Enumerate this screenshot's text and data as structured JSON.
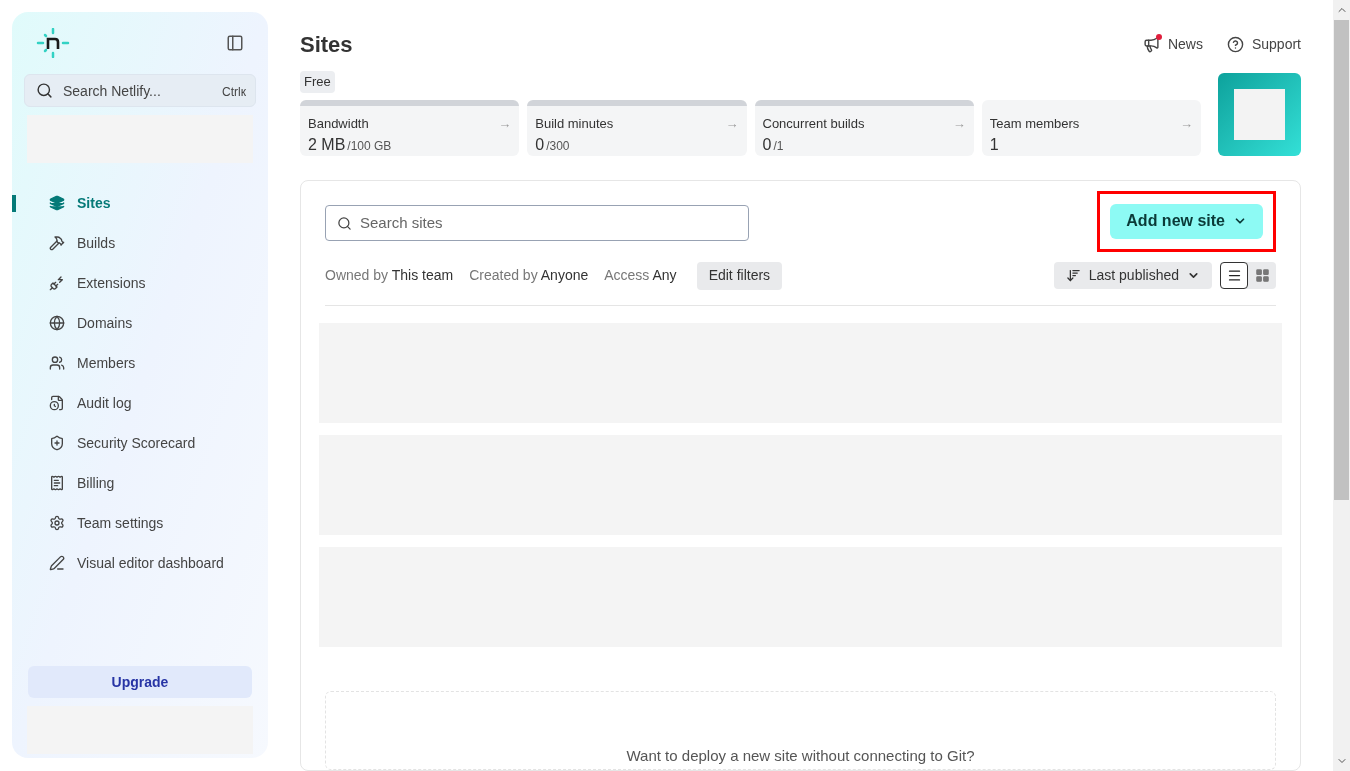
{
  "sidebar": {
    "search": {
      "placeholder": "Search Netlify...",
      "shortcut": "Ctrlк"
    },
    "items": [
      {
        "label": "Sites",
        "selected": true
      },
      {
        "label": "Builds",
        "selected": false
      },
      {
        "label": "Extensions",
        "selected": false
      },
      {
        "label": "Domains",
        "selected": false
      },
      {
        "label": "Members",
        "selected": false
      },
      {
        "label": "Audit log",
        "selected": false
      },
      {
        "label": "Security Scorecard",
        "selected": false
      },
      {
        "label": "Billing",
        "selected": false
      },
      {
        "label": "Team settings",
        "selected": false
      },
      {
        "label": "Visual editor dashboard",
        "selected": false
      }
    ],
    "upgrade": "Upgrade"
  },
  "header": {
    "title": "Sites",
    "news": {
      "label": "News",
      "unread": true
    },
    "support": "Support"
  },
  "plan": "Free",
  "usage": [
    {
      "label": "Bandwidth",
      "value": "2 MB",
      "limit": "/100 GB",
      "meter": true,
      "arrow": "→"
    },
    {
      "label": "Build minutes",
      "value": "0",
      "limit": "/300",
      "meter": true,
      "arrow": "→"
    },
    {
      "label": "Concurrent builds",
      "value": "0",
      "limit": "/1",
      "meter": true,
      "arrow": "→"
    },
    {
      "label": "Team members",
      "value": "1",
      "meter": false,
      "arrow": "→"
    }
  ],
  "sites": {
    "search": {
      "placeholder": "Search sites"
    },
    "add_button": {
      "label": "Add new site",
      "highlighted": true
    },
    "filters": [
      {
        "label": "Owned by",
        "value": "This team"
      },
      {
        "label": "Created by",
        "value": "Anyone"
      },
      {
        "label": "Access",
        "value": "Any"
      }
    ],
    "edit_filters": "Edit filters",
    "sort": "Last published",
    "views": [
      {
        "kind": "list",
        "selected": true
      },
      {
        "kind": "grid",
        "selected": false
      }
    ],
    "deploy_prompt": "Want to deploy a new site without connecting to Git?"
  }
}
